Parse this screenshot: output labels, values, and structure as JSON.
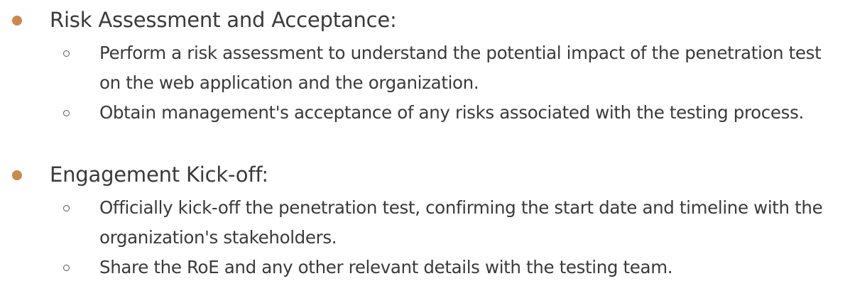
{
  "sections": [
    {
      "heading": "Risk Assessment and Acceptance:",
      "items": [
        "Perform a risk assessment to understand the potential impact of the penetration test on the web application and the organization.",
        "Obtain management's acceptance of any risks associated with the testing process."
      ]
    },
    {
      "heading": "Engagement Kick-off:",
      "items": [
        "Officially kick-off the penetration test, confirming the start date and timeline with the organization's stakeholders.",
        "Share the RoE and any other relevant details with the testing team."
      ]
    }
  ],
  "colors": {
    "bullet_primary": "#c98a4a",
    "text": "#3a3a3a"
  }
}
